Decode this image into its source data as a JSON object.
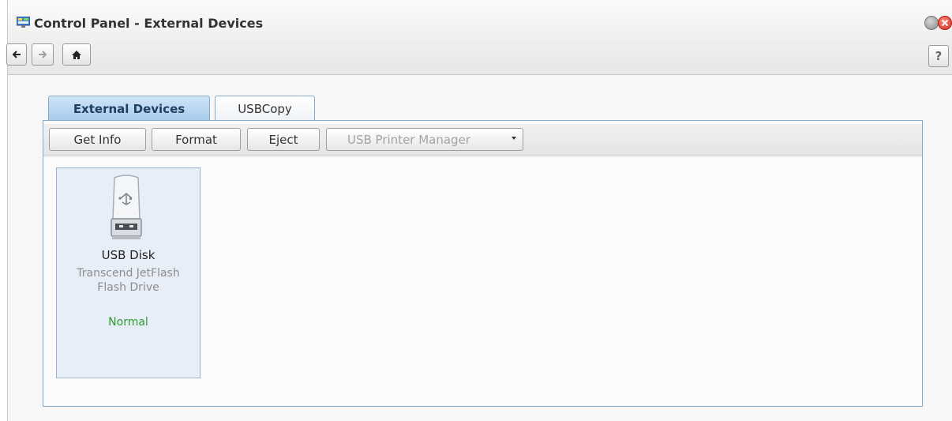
{
  "window": {
    "title": "Control Panel - External Devices",
    "icon": "control-panel-icon"
  },
  "nav": {
    "back_icon": "arrow-left-icon",
    "forward_icon": "arrow-right-icon",
    "home_icon": "home-icon",
    "help_label": "?"
  },
  "tabs": [
    {
      "label": "External Devices",
      "active": true
    },
    {
      "label": "USBCopy",
      "active": false
    }
  ],
  "toolbar": {
    "get_info": "Get Info",
    "format": "Format",
    "eject": "Eject",
    "printer_manager": "USB Printer Manager"
  },
  "devices": [
    {
      "name": "USB Disk",
      "model": "Transcend JetFlash Flash Drive",
      "status": "Normal",
      "icon": "usb-drive-icon"
    }
  ],
  "colors": {
    "status_normal": "#2e9a2e",
    "tab_active_bg": "#a7cbeb",
    "close_button": "#d42a1c"
  }
}
